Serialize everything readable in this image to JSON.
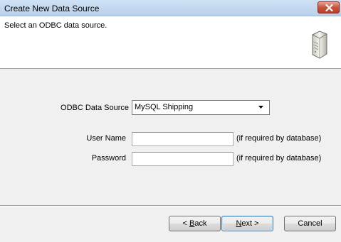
{
  "window": {
    "title": "Create New Data Source",
    "close_label": "Close"
  },
  "header": {
    "instruction": "Select an ODBC data source.",
    "icon": "server-icon"
  },
  "form": {
    "data_source_label": "ODBC Data Source",
    "data_source_value": "MySQL Shipping",
    "user_name_label": "User Name",
    "user_name_value": "",
    "user_name_hint": "(if required by database)",
    "password_label": "Password",
    "password_value": "",
    "password_hint": "(if required by database)"
  },
  "buttons": {
    "back_prefix": "< ",
    "back_mnemonic": "B",
    "back_rest": "ack",
    "next_mnemonic": "N",
    "next_rest": "ext >",
    "cancel": "Cancel"
  }
}
